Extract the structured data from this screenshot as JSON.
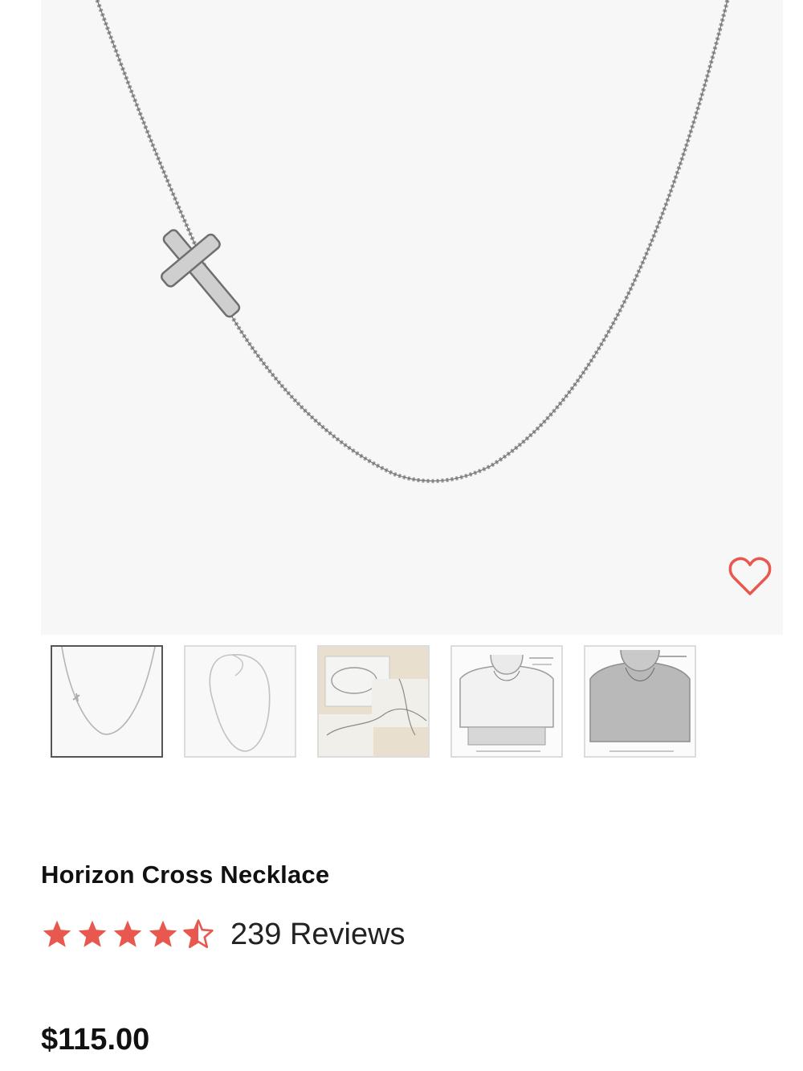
{
  "product": {
    "title": "Horizon Cross Necklace",
    "reviews_label": "239 Reviews",
    "price": "$115.00",
    "rating": 4.5,
    "rating_max": 5
  },
  "gallery": {
    "thumbnails": [
      {
        "name": "necklace-front-view",
        "selected": true
      },
      {
        "name": "necklace-full-chain-view",
        "selected": false
      },
      {
        "name": "gift-box-view",
        "selected": false
      },
      {
        "name": "length-guide-short",
        "selected": false
      },
      {
        "name": "length-guide-long",
        "selected": false
      }
    ]
  },
  "colors": {
    "accent": "#e8584f",
    "text": "#111111",
    "hero_background": "#f7f7f7",
    "thumb_border_active": "#555555",
    "thumb_border": "#dcdcdc"
  },
  "icons": {
    "wishlist": "heart-outline-icon",
    "star_full": "star-icon",
    "star_half": "star-half-icon"
  }
}
